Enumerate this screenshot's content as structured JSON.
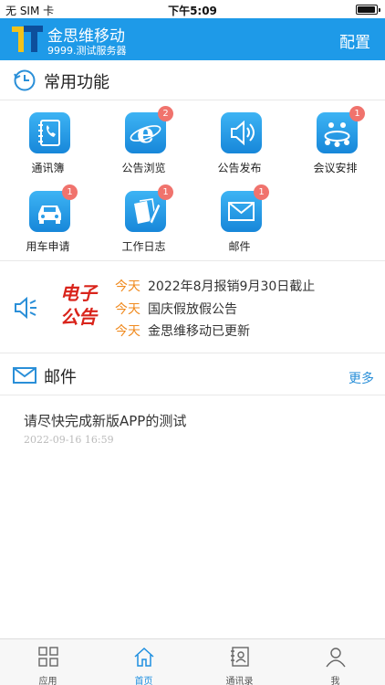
{
  "status_bar": {
    "carrier": "无 SIM 卡",
    "time": "下午5:09",
    "battery_level": 0.95
  },
  "header": {
    "app_name": "金思维移动",
    "server": "9999.测试服务器",
    "config_label": "配置"
  },
  "functions": {
    "title": "常用功能",
    "items": [
      {
        "label": "通讯簿",
        "icon": "address-book-icon",
        "badge": ""
      },
      {
        "label": "公告浏览",
        "icon": "browser-e-icon",
        "badge": "2"
      },
      {
        "label": "公告发布",
        "icon": "speaker-icon",
        "badge": ""
      },
      {
        "label": "会议安排",
        "icon": "meeting-icon",
        "badge": "1"
      },
      {
        "label": "用车申请",
        "icon": "car-icon",
        "badge": "1"
      },
      {
        "label": "工作日志",
        "icon": "notebook-pen-icon",
        "badge": "1"
      },
      {
        "label": "邮件",
        "icon": "envelope-icon",
        "badge": "1"
      }
    ]
  },
  "notice": {
    "brand_line1": "电子",
    "brand_line2": "公告",
    "items": [
      {
        "tag": "今天",
        "text": "2022年8月报销9月30日截止"
      },
      {
        "tag": "今天",
        "text": "国庆假放假公告"
      },
      {
        "tag": "今天",
        "text": "金思维移动已更新"
      }
    ]
  },
  "mail": {
    "title": "邮件",
    "more_label": "更多",
    "items": [
      {
        "subject": "请尽快完成新版APP的测试",
        "time": "2022-09-16 16:59"
      }
    ]
  },
  "tabbar": {
    "items": [
      {
        "label": "应用",
        "icon": "grid-icon"
      },
      {
        "label": "首页",
        "icon": "home-icon",
        "active": true
      },
      {
        "label": "通讯录",
        "icon": "contacts-icon"
      },
      {
        "label": "我",
        "icon": "person-icon"
      }
    ]
  },
  "colors": {
    "primary": "#1e9ae8",
    "badge": "#f0736d",
    "notice_tag": "#f08a1e",
    "notice_brand": "#d9241b"
  }
}
